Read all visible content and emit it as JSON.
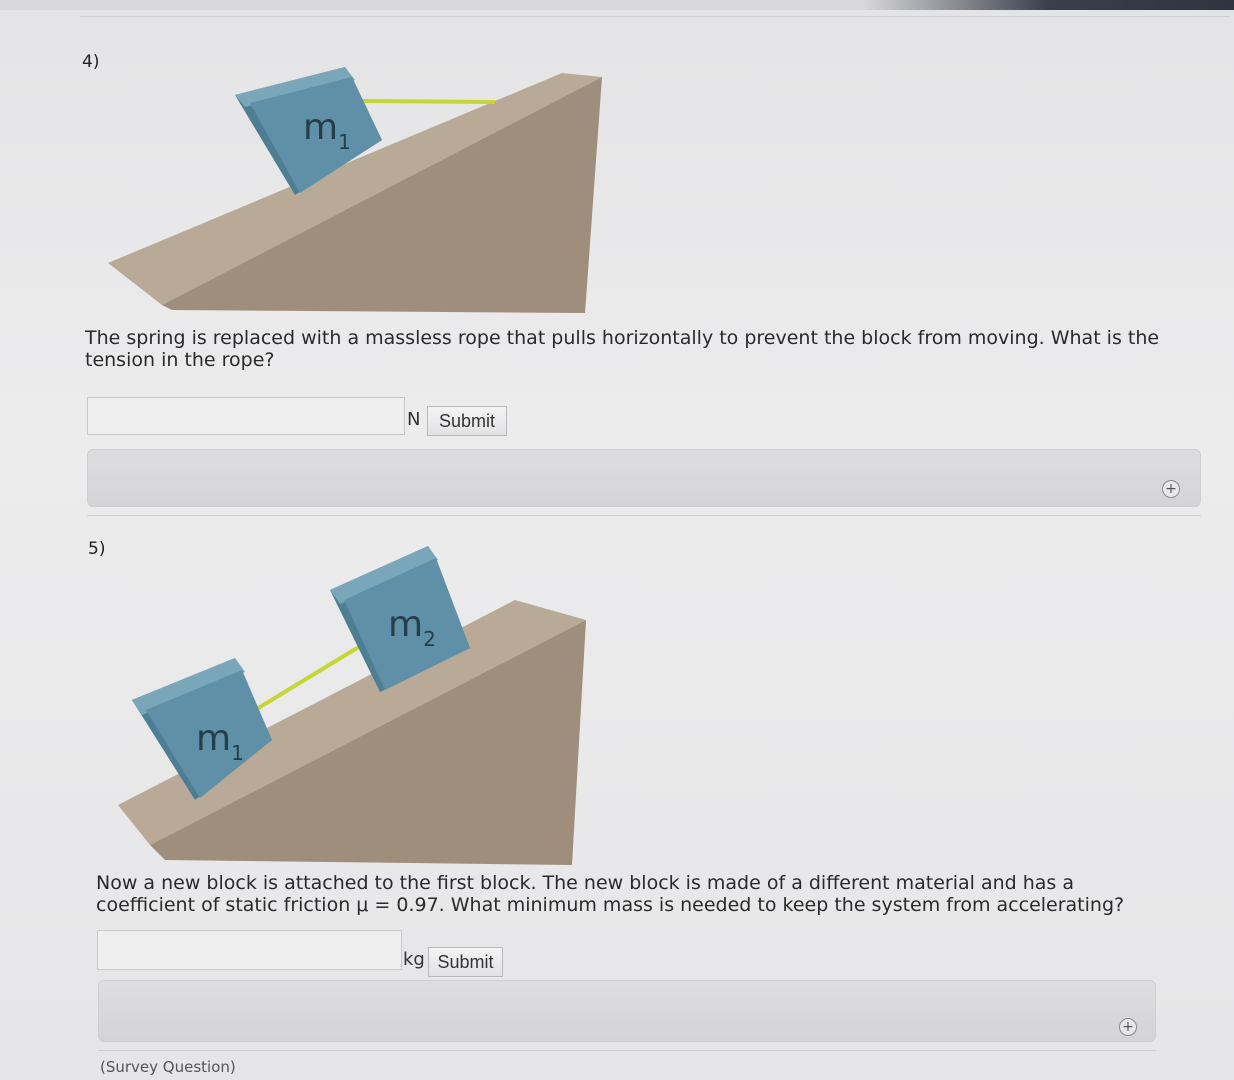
{
  "questions": [
    {
      "number": "4)",
      "figure": {
        "block_label_main": "m",
        "block_label_sub": "1"
      },
      "text": "The spring is replaced with a massless rope that pulls horizontally to prevent the block from moving. What is the tension in the rope?",
      "answer_value": "",
      "unit": "N",
      "submit_label": "Submit",
      "expand_icon": "plus-circle-icon"
    },
    {
      "number": "5)",
      "figure": {
        "block1_label_main": "m",
        "block1_label_sub": "1",
        "block2_label_main": "m",
        "block2_label_sub": "2"
      },
      "text": "Now a new block is attached to the first block. The new block is made of a different material and has a coefficient of static friction μ = 0.97. What minimum mass is needed to keep the system from accelerating?",
      "answer_value": "",
      "unit": "kg",
      "submit_label": "Submit",
      "expand_icon": "plus-circle-icon"
    }
  ],
  "footer": {
    "survey_label": "(Survey Question)"
  },
  "colors": {
    "block": "#5e8fa6",
    "block_dark": "#4a7689",
    "ramp_top": "#b7a897",
    "ramp_side": "#9c8b7a",
    "rope": "#c8d836"
  }
}
